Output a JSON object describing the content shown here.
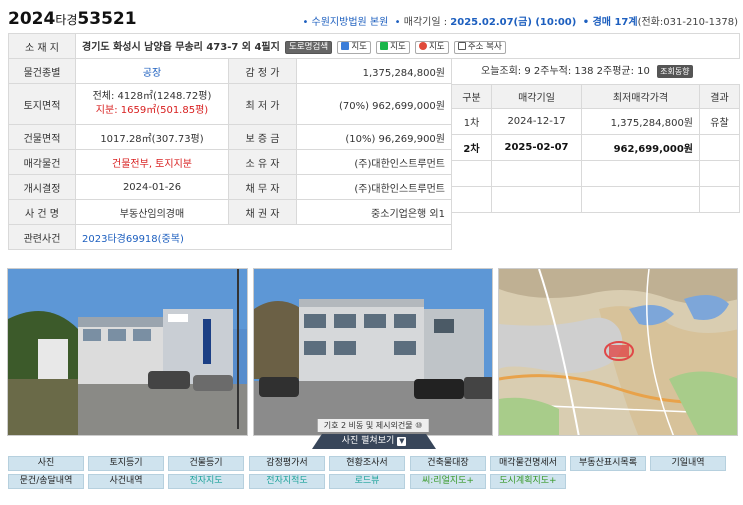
{
  "header": {
    "case_year": "2024",
    "case_mid": "타경",
    "case_num": "53521",
    "court": "• 수원지방법원 본원",
    "date_label": "• 매각기일 : ",
    "date_value": "2025.02.07(금) (10:00)",
    "dept_label": "• 경매 17계",
    "phone": "(전화:031-210-1378)"
  },
  "info": {
    "addr_label": "소 재 지",
    "addr": "경기도 화성시 남양읍 무송리 473-7 외 4필지",
    "addr_btns": [
      "도로명검색",
      "지도",
      "지도",
      "지도",
      "주소 복사"
    ],
    "type_label": "물건종별",
    "type": "공장",
    "appraisal_label": "감 정 가",
    "appraisal": "1,375,284,800원",
    "land_label": "토지면적",
    "land_total": "전체: 4128㎡(1248.72평)",
    "land_share": "지분: 1659㎡(501.85평)",
    "min_label": "최 저 가",
    "min_price": "(70%) 962,699,000원",
    "bldg_label": "건물면적",
    "bldg": "1017.28㎡(307.73평)",
    "deposit_label": "보 증 금",
    "deposit": "(10%) 96,269,900원",
    "sale_label": "매각물건",
    "sale": "건물전부, 토지지분",
    "owner_label": "소 유 자",
    "owner": "(주)대한인스트루먼트",
    "start_label": "개시결정",
    "start": "2024-01-26",
    "debtor_label": "채 무 자",
    "debtor": "(주)대한인스트루먼트",
    "casename_label": "사 건 명",
    "casename": "부동산임의경매",
    "creditor_label": "채 권 자",
    "creditor": "중소기업은행 외1",
    "related_label": "관련사건",
    "related": "2023타경69918(중복)"
  },
  "stats": {
    "text": "오늘조회: 9  2주누적: 138  2주평균: 10",
    "btn": "조회동향"
  },
  "history": {
    "headers": [
      "구분",
      "매각기일",
      "최저매각가격",
      "결과"
    ],
    "rows": [
      [
        "1차",
        "2024-12-17",
        "1,375,284,800원",
        "유찰"
      ],
      [
        "2차",
        "2025-02-07",
        "962,699,000원",
        ""
      ]
    ]
  },
  "photos": {
    "caption2": "기호 2 비동 및 제시외건물 ⑩",
    "view_all": "사진 펼쳐보기"
  },
  "nav": {
    "row1": [
      "사진",
      "토지등기",
      "건물등기",
      "감정평가서",
      "현황조사서",
      "건축물대장",
      "매각물건명세서",
      "부동산표시목록",
      "기일내역"
    ],
    "row2": [
      "문건/송달내역",
      "사건내역",
      "전자지도",
      "전자지적도",
      "로드뷰",
      "씨:리얼지도+",
      "도시계획지도+"
    ]
  }
}
